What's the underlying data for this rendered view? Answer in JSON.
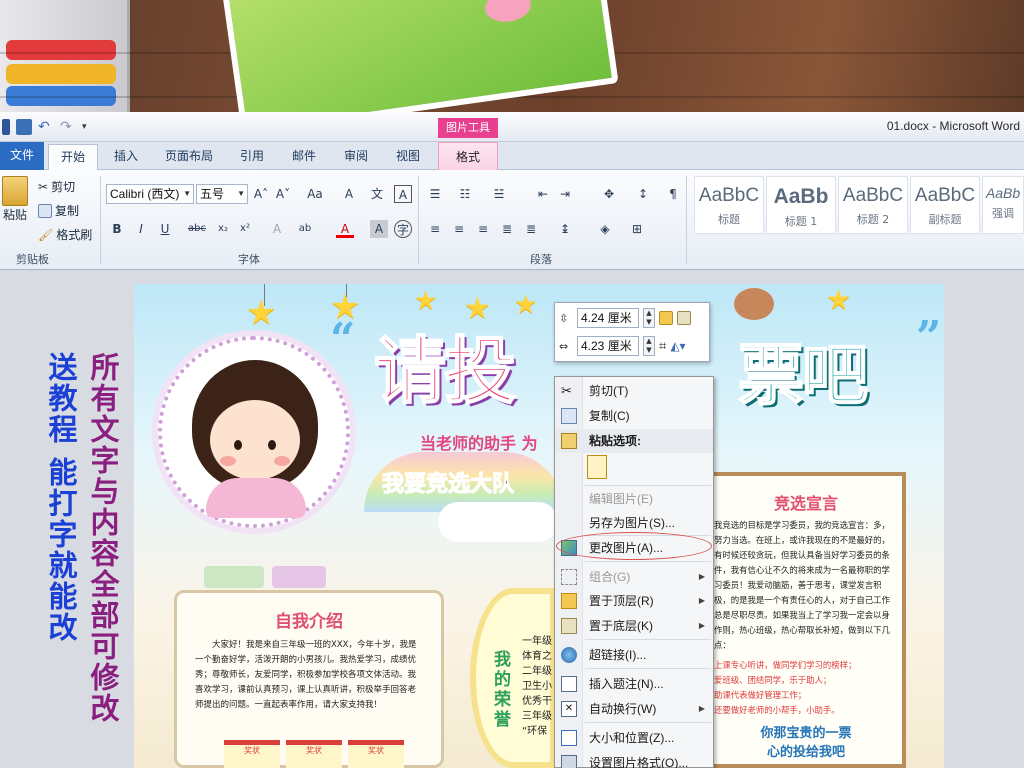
{
  "window": {
    "title": "01.docx  -  Microsoft Word"
  },
  "contextual_tab_group": "图片工具",
  "tabs": [
    "文件",
    "开始",
    "插入",
    "页面布局",
    "引用",
    "邮件",
    "审阅",
    "视图",
    "格式"
  ],
  "ribbon": {
    "clipboard": {
      "paste": "粘贴",
      "cut": "剪切",
      "copy": "复制",
      "format_painter": "格式刷",
      "label": "剪贴板"
    },
    "font": {
      "name": "Calibri (西文)",
      "size": "五号",
      "label": "字体"
    },
    "paragraph": {
      "label": "段落"
    },
    "styles": [
      {
        "preview": "AaBbC",
        "name": "标题"
      },
      {
        "preview": "AaBb",
        "name": "标题 1"
      },
      {
        "preview": "AaBbC",
        "name": "标题 2"
      },
      {
        "preview": "AaBbC",
        "name": "副标题"
      },
      {
        "preview": "AaBb",
        "name": "强调"
      }
    ]
  },
  "mini_toolbar": {
    "height": "4.24 厘米",
    "width": "4.23 厘米"
  },
  "context_menu": {
    "items": [
      {
        "label": "剪切(T)",
        "icon": "scissors-icon"
      },
      {
        "label": "复制(C)",
        "icon": "copy-icon"
      },
      {
        "label": "粘贴选项:",
        "icon": "paste-icon"
      },
      {
        "label": "编辑图片(E)",
        "icon": ""
      },
      {
        "label": "另存为图片(S)...",
        "icon": ""
      },
      {
        "label": "更改图片(A)...",
        "icon": "change-picture-icon"
      },
      {
        "label": "组合(G)",
        "icon": "group-icon"
      },
      {
        "label": "置于顶层(R)",
        "icon": "bring-front-icon"
      },
      {
        "label": "置于底层(K)",
        "icon": "send-back-icon"
      },
      {
        "label": "超链接(I)...",
        "icon": "hyperlink-icon"
      },
      {
        "label": "插入题注(N)...",
        "icon": "caption-icon"
      },
      {
        "label": "自动换行(W)",
        "icon": "wrap-icon"
      },
      {
        "label": "大小和位置(Z)...",
        "icon": "size-position-icon"
      },
      {
        "label": "设置图片格式(O)...",
        "icon": "format-picture-icon"
      }
    ]
  },
  "poster": {
    "title_left": "请投",
    "title_right": "票吧",
    "quote_open": "“",
    "quote_close": "”",
    "subtitle": "当老师的助手  为",
    "slogan": "我要竞选大队",
    "self_intro_title": "自我介绍",
    "self_intro_text": "大家好！我是来自三年级一班的XXX，今年十岁，我是一个勤奋好学，活泼开朗的小男孩儿。我热爱学习，成绩优秀；尊敬师长，友爱同学，积极参加学校各项文体活动。我喜欢学习，课前认真预习，课上认真听讲，积极举手回答老师提出的问题。一直起表率作用，请大家支持我！",
    "honor_title": "我的荣誉",
    "honor_lines": [
      "一年级",
      "体育之",
      "二年级",
      "卫生小",
      "优秀干",
      "三年级",
      "“环保"
    ],
    "speech_title": "竞选宣言",
    "speech_text": "我竞选的目标是学习委员，我的竞选宣言：多，努力当选。在班上，或许我现在的不是最好的，有时候还较贪玩，但我认具备当好学习委员的条件，我有信心让不久的将来成为一名最称职的学习委员！我爱动脑筋，善于思考，课堂发言积极，的是我是一个有责任心的人，对于自己工作总是尽职尽责。如果我当上了学习我一定会以身作则，热心班级，热心帮取长补短，做到以下几点：",
    "speech_red": [
      "上课专心听讲，做同学们学习的榜样；",
      "爱班级、团结同学，乐于助人；",
      "助课代表做好管理工作；",
      "还要做好老师的小帮手，小助手。"
    ],
    "speech_footer_1": "你那宝贵的一票",
    "speech_footer_2": "心的投给我吧",
    "note_label": "奖状"
  },
  "side_text": {
    "col1": "送教程 能打字就能改",
    "col2": "所有文字与内容全部可修改"
  }
}
